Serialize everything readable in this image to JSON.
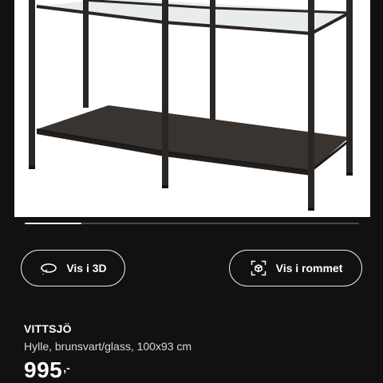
{
  "gallery": {
    "progress": 0.17
  },
  "actions": {
    "view_3d_label": "Vis i 3D",
    "view_room_label": "Vis i rommet",
    "view_3d_icon": "rotate-3d-icon",
    "view_room_icon": "ar-cube-icon"
  },
  "product": {
    "name": "VITTSJÖ",
    "description": "Hylle, brunsvart/glass, 100x93 cm",
    "price": "995",
    "price_suffix": ",-"
  },
  "colors": {
    "background": "#111111",
    "image_background": "#ffffff",
    "frame": "#2a2623",
    "text": "#ffffff"
  }
}
